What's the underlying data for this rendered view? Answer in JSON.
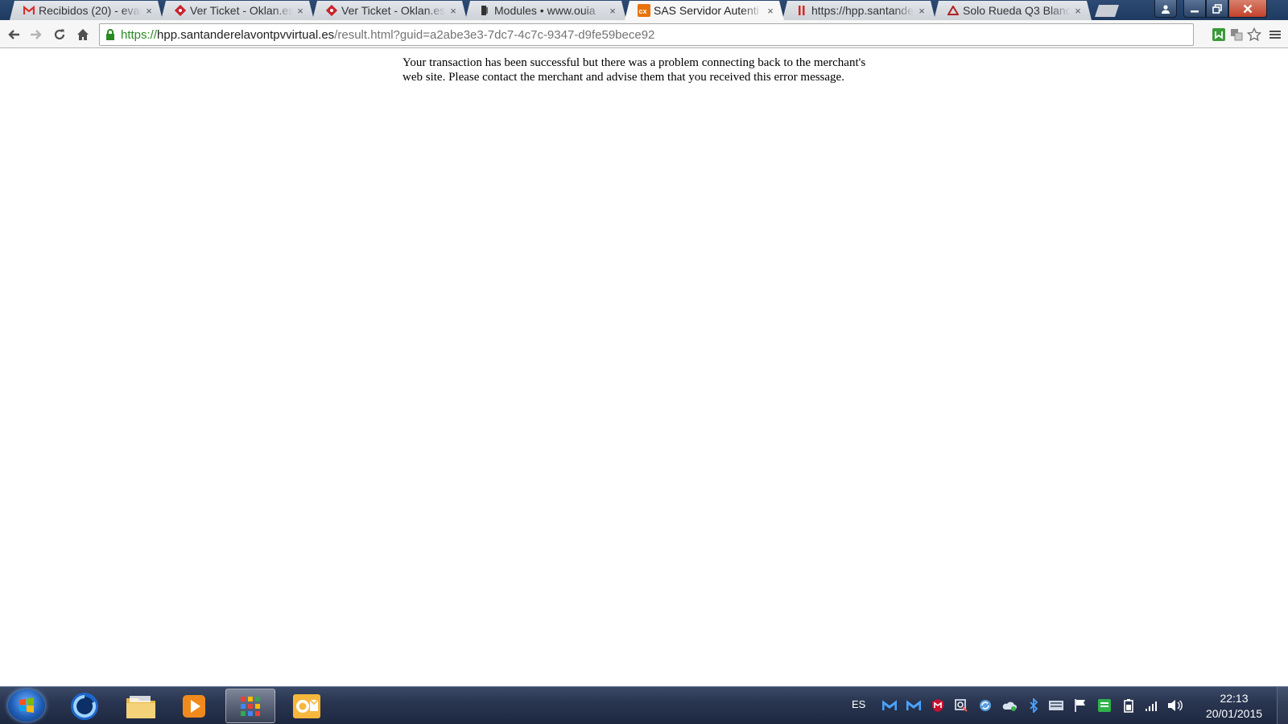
{
  "browser": {
    "tabs": [
      {
        "title": "Recibidos (20) - evar",
        "favicon": "gmail-icon",
        "active": false
      },
      {
        "title": "Ver Ticket - Oklan.es",
        "favicon": "oklan-icon",
        "active": false
      },
      {
        "title": "Ver Ticket - Oklan.es",
        "favicon": "oklan-icon",
        "active": false
      },
      {
        "title": "Modules • www.ouia",
        "favicon": "github-icon",
        "active": false
      },
      {
        "title": "SAS Servidor Autenti",
        "favicon": "sas-icon",
        "active": true
      },
      {
        "title": "https://hpp.santande",
        "favicon": "santander-icon",
        "active": false
      },
      {
        "title": "Solo Rueda Q3 Blanc",
        "favicon": "solorueda-icon",
        "active": false
      }
    ],
    "tab_close_glyph": "×",
    "address": {
      "scheme": "https://",
      "host": "hpp.santanderelavontpvvirtual.es",
      "path": "/result.html?guid=a2abe3e3-7dc7-4c7c-9347-d9fe59bece92"
    },
    "colors": {
      "secure_green": "#2a8a22",
      "frame_blue": "#1f3a60",
      "sas_orange": "#e8730c",
      "gmail_red": "#d93025",
      "oklan_red": "#c8232c"
    }
  },
  "page": {
    "message": "Your transaction has been successful but there was a problem connecting back to the merchant's web site. Please contact the merchant and advise them that you received this error message."
  },
  "taskbar": {
    "language": "ES",
    "time": "22:13",
    "date": "20/01/2015"
  }
}
